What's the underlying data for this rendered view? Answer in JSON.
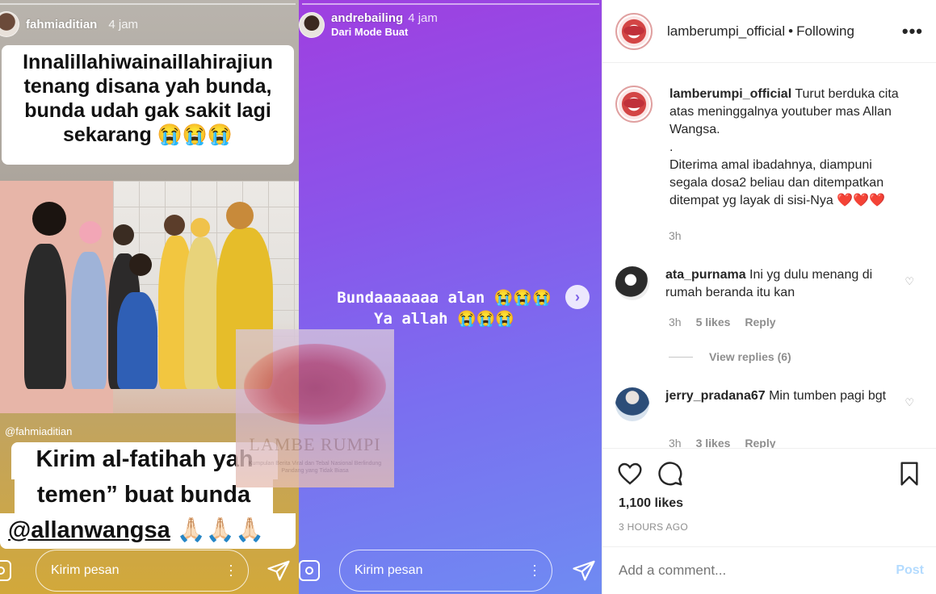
{
  "story1": {
    "username": "fahmiaditian",
    "time": "4 jam",
    "top_text": "Innalillahiwainaillahirajiun tenang disana yah bunda, bunda udah gak sakit lagi sekarang 😭😭😭",
    "tag": "@fahmiaditian",
    "bottom_line1": "Kirim al-fatihah yah",
    "bottom_line2": "temen” buat bunda",
    "bottom_mention": "@allanwangsa",
    "bottom_emoji": " 🙏🏻🙏🏻🙏🏻",
    "reply_placeholder": "Kirim pesan"
  },
  "story2": {
    "username": "andrebailing",
    "time": "4 jam",
    "subtitle": "Dari Mode Buat",
    "text_line1": "Bundaaaaaaa alan 😭😭😭",
    "text_line2": "Ya allah 😭😭😭",
    "reply_placeholder": "Kirim pesan"
  },
  "watermark": {
    "title": "LAMBE RUMPI",
    "subtitle": "Kumpulan Berita Viral dan Tebal Nasional Berlindung Pandang yang Tidak Biasa"
  },
  "post": {
    "header": {
      "username": "lamberumpi_official",
      "separator": "•",
      "follow_status": "Following",
      "more": "•••"
    },
    "caption": {
      "username": "lamberumpi_official",
      "text_line1": "Turut berduka cita atas meninggalnya youtuber mas Allan Wangsa.",
      "text_dot": ".",
      "text_line2": "Diterima amal ibadahnya, diampuni segala dosa2 beliau dan ditempatkan ditempat yg layak di sisi-Nya ❤️❤️❤️",
      "time": "3h"
    },
    "comments": [
      {
        "username": "ata_purnama",
        "text": "Ini yg dulu menang di rumah beranda itu kan",
        "time": "3h",
        "likes": "5 likes",
        "reply": "Reply",
        "view_replies": "View replies (6)"
      },
      {
        "username": "jerry_pradana67",
        "text": "Min tumben pagi bgt",
        "time": "3h",
        "likes": "3 likes",
        "reply": "Reply"
      }
    ],
    "likes": "1,100 likes",
    "time_ago": "3 HOURS AGO",
    "add_comment_placeholder": "Add a comment...",
    "post_label": "Post"
  },
  "colors": {
    "story2_gradient_start": "#9f3fe0",
    "story2_gradient_end": "#6f8bf2",
    "post_button": "#b3dbff",
    "meta_text": "#8e8e8e"
  }
}
